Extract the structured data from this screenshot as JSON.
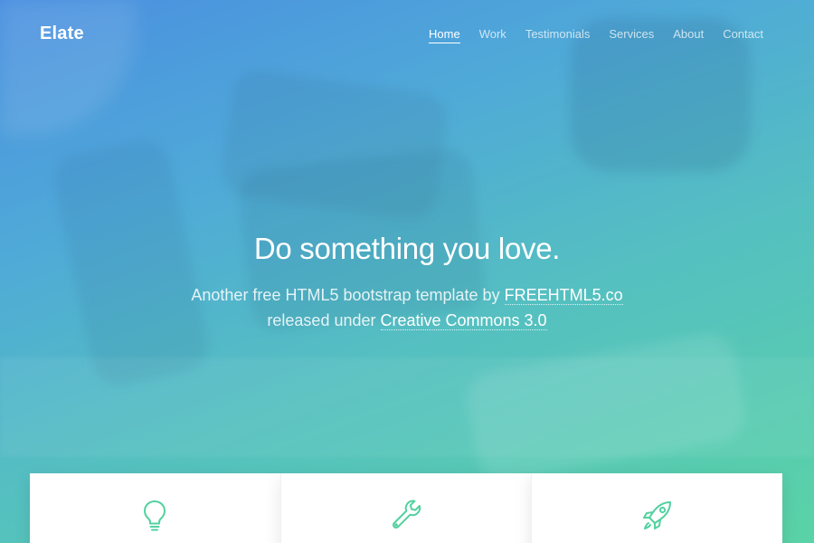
{
  "brand": {
    "name": "Elate"
  },
  "nav": {
    "items": [
      {
        "label": "Home",
        "active": true
      },
      {
        "label": "Work",
        "active": false
      },
      {
        "label": "Testimonials",
        "active": false
      },
      {
        "label": "Services",
        "active": false
      },
      {
        "label": "About",
        "active": false
      },
      {
        "label": "Contact",
        "active": false
      }
    ]
  },
  "hero": {
    "title": "Do something you love.",
    "line1_prefix": "Another free HTML5 bootstrap template by ",
    "line1_link": "FREEHTML5.co",
    "line2_prefix": "released under ",
    "line2_link": "Creative Commons 3.0"
  },
  "features": [
    {
      "icon": "lightbulb-icon"
    },
    {
      "icon": "wrench-icon"
    },
    {
      "icon": "rocket-icon"
    }
  ],
  "colors": {
    "gradient_start": "#4a8fe0",
    "gradient_end": "#5ad3a6",
    "icon_accent": "#52d1a0"
  }
}
